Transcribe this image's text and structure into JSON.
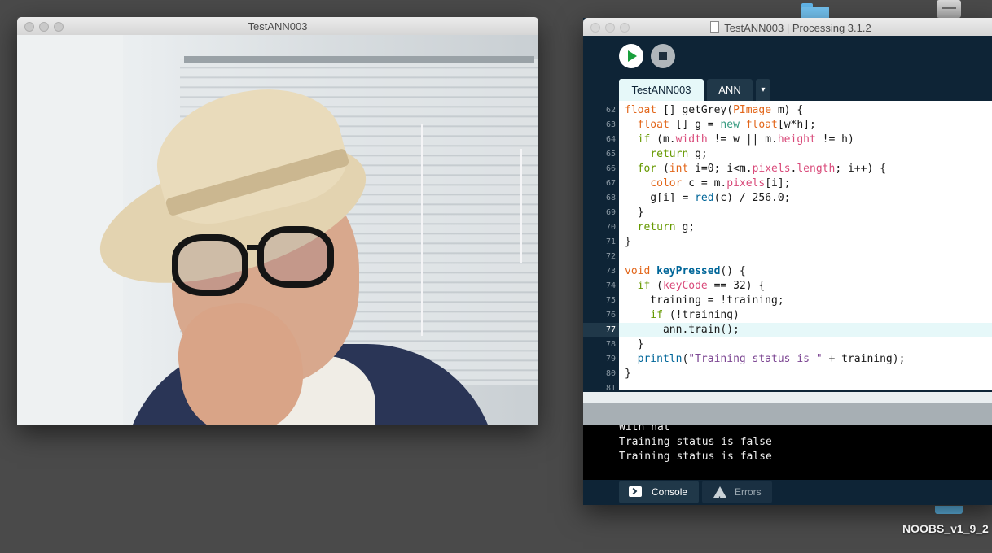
{
  "camera_window": {
    "title": "TestANN003"
  },
  "ide_window": {
    "title": "TestANN003 | Processing 3.1.2",
    "tabs": [
      {
        "label": "TestANN003",
        "active": true
      },
      {
        "label": "ANN",
        "active": false
      }
    ],
    "tab_menu_glyph": "▾",
    "current_line": 77,
    "code_lines": [
      {
        "num": "62",
        "text": "float [] getGrey(PImage m) {"
      },
      {
        "num": "63",
        "text": "  float [] g = new float[w*h];"
      },
      {
        "num": "64",
        "text": "  if (m.width != w || m.height != h)"
      },
      {
        "num": "65",
        "text": "    return g;"
      },
      {
        "num": "66",
        "text": "  for (int i=0; i<m.pixels.length; i++) {"
      },
      {
        "num": "67",
        "text": "    color c = m.pixels[i];"
      },
      {
        "num": "68",
        "text": "    g[i] = red(c) / 256.0;"
      },
      {
        "num": "69",
        "text": "  }"
      },
      {
        "num": "70",
        "text": "  return g;"
      },
      {
        "num": "71",
        "text": "}"
      },
      {
        "num": "72",
        "text": ""
      },
      {
        "num": "73",
        "text": "void keyPressed() {"
      },
      {
        "num": "74",
        "text": "  if (keyCode == 32) {"
      },
      {
        "num": "75",
        "text": "    training = !training;"
      },
      {
        "num": "76",
        "text": "    if (!training)"
      },
      {
        "num": "77",
        "text": "      ann.train();"
      },
      {
        "num": "78",
        "text": "  }"
      },
      {
        "num": "79",
        "text": "  println(\"Training status is \" + training);"
      },
      {
        "num": "80",
        "text": "}"
      },
      {
        "num": "81",
        "text": ""
      }
    ],
    "console_lines": [
      "With hat",
      "Training status is false",
      "Training status is false"
    ],
    "bottom_tabs": {
      "console": "Console",
      "errors": "Errors"
    }
  },
  "desktop": {
    "sd_card_label": "NOOBS_v1_9_2"
  },
  "colors": {
    "ide_dark": "#0e2436",
    "run_green": "#189f3c",
    "keyword_orange": "#e2661a",
    "keyword_teal": "#33997e",
    "function_blue": "#006699",
    "property_pink": "#d94a7a",
    "string_purple": "#7d4793"
  }
}
